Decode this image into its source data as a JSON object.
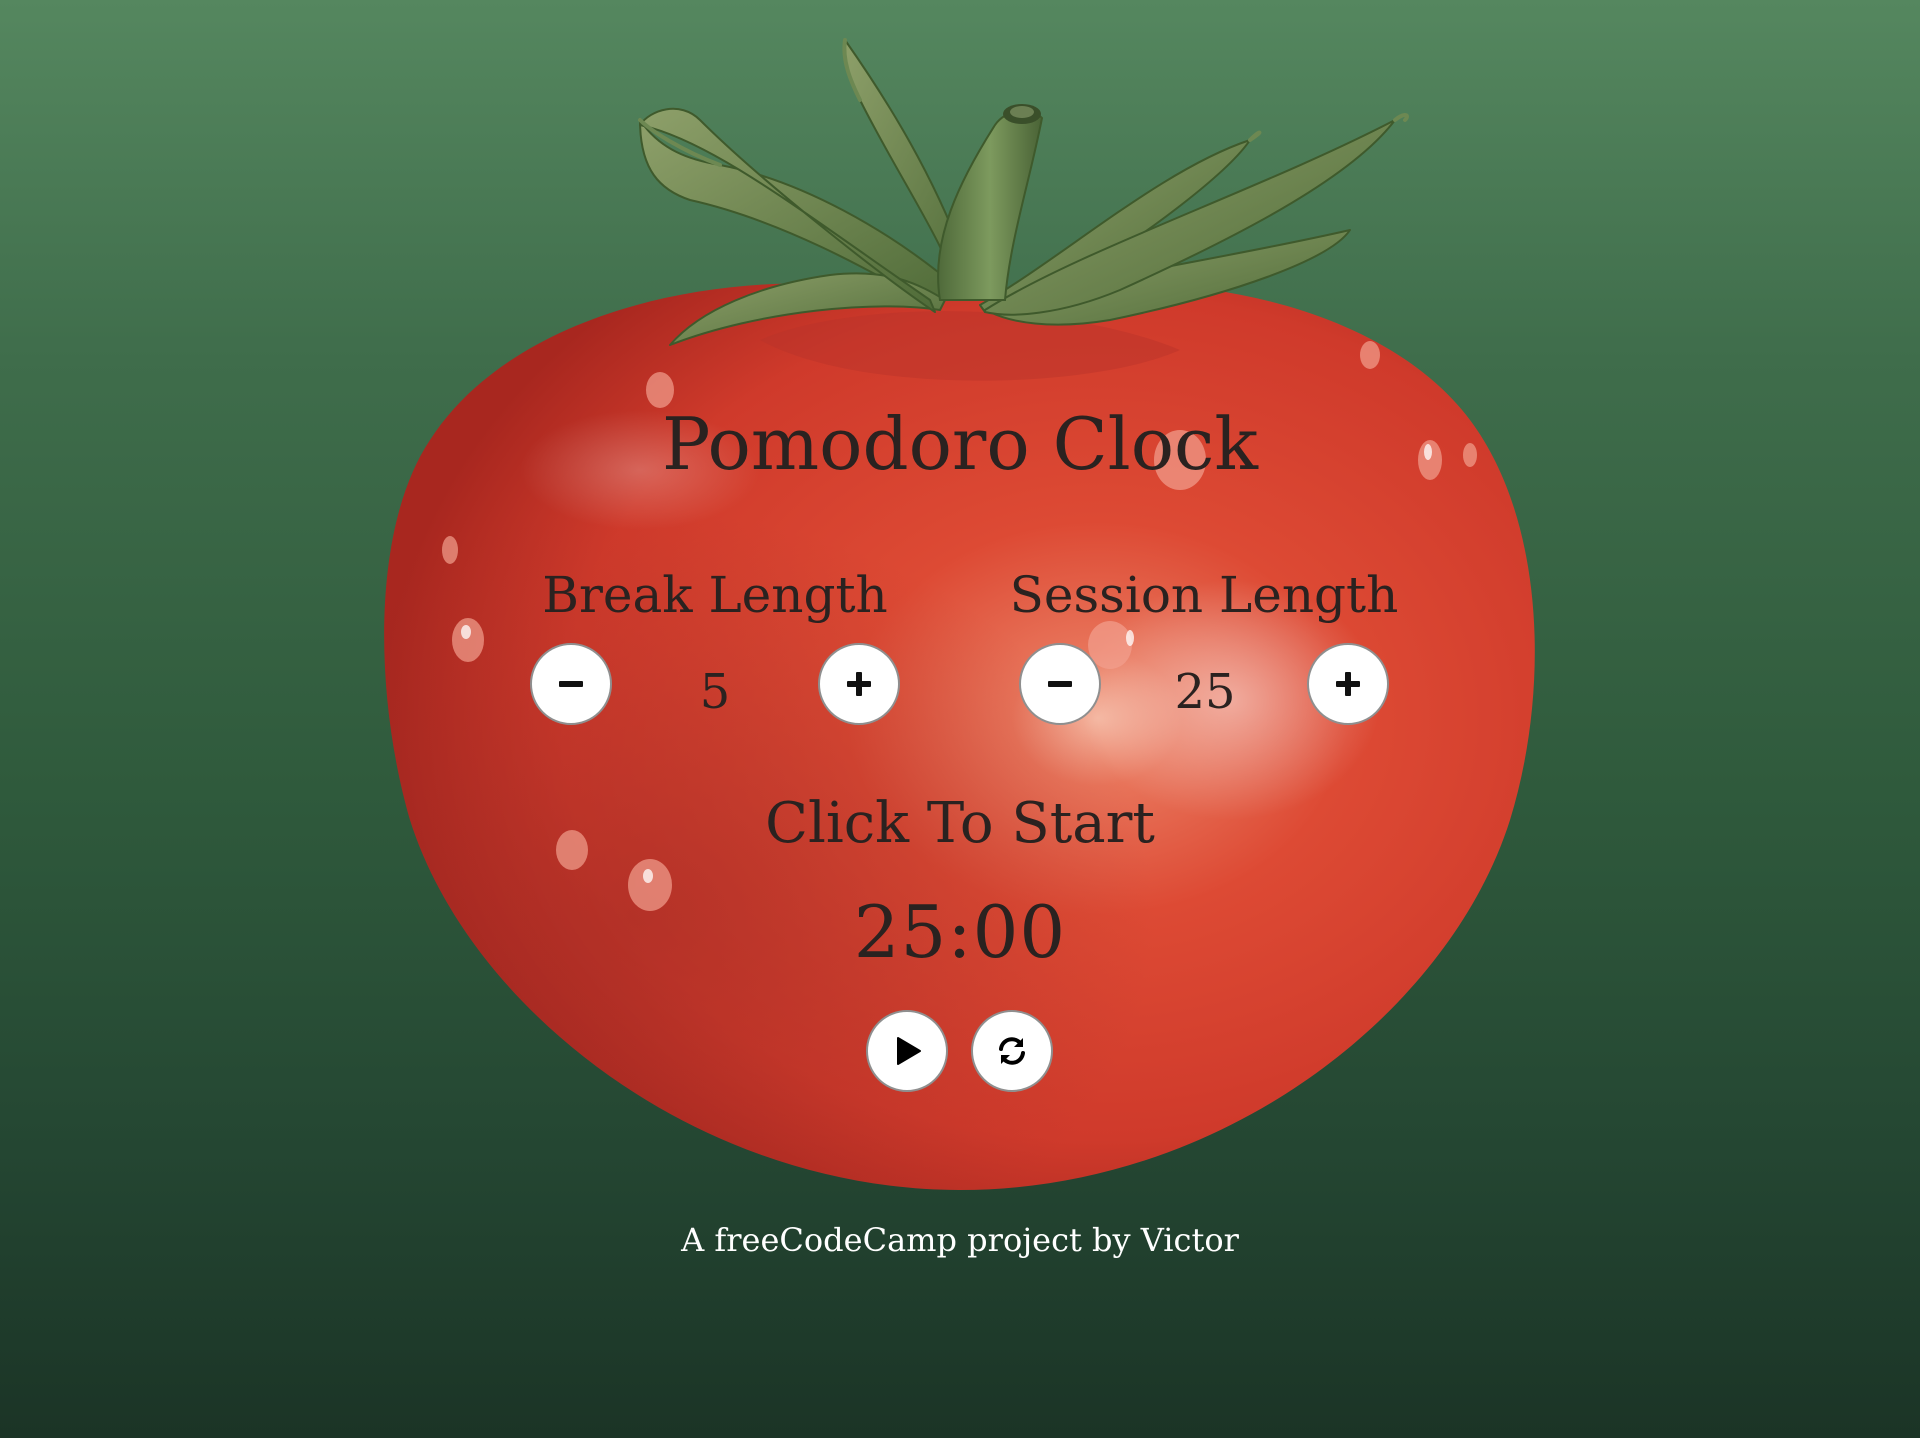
{
  "title": "Pomodoro Clock",
  "break": {
    "label": "Break Length",
    "value": "5",
    "decrement_icon": "minus-icon",
    "increment_icon": "plus-icon"
  },
  "session": {
    "label": "Session Length",
    "value": "25",
    "decrement_icon": "minus-icon",
    "increment_icon": "plus-icon"
  },
  "status": "Click To Start",
  "timer": "25:00",
  "controls": {
    "play_icon": "play-icon",
    "reset_icon": "refresh-icon"
  },
  "footer": "A freeCodeCamp project by Victor",
  "colors": {
    "background_top": "#55875f",
    "background_bottom": "#1b3426",
    "tomato": "#d9432f",
    "leaves": "#6a8a4e",
    "text": "#2a2220",
    "footer_text": "#ffffff",
    "button_bg": "#ffffff"
  }
}
